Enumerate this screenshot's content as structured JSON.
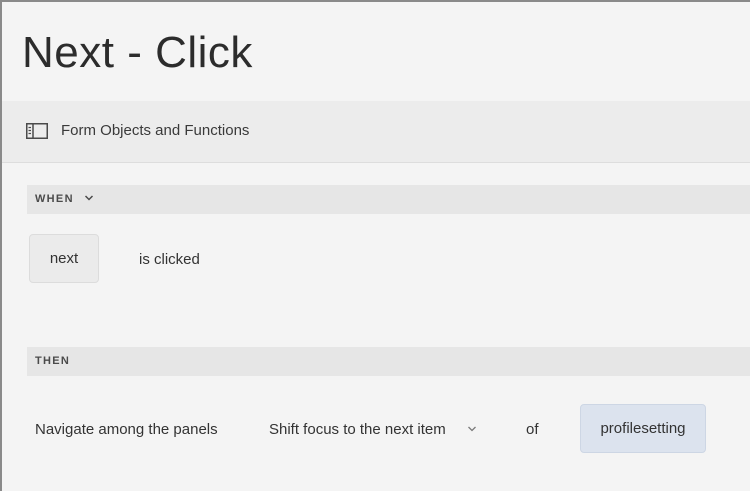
{
  "page": {
    "title": "Next - Click"
  },
  "toolbar": {
    "icon": "panel-icon",
    "label": "Form Objects and Functions"
  },
  "when": {
    "label": "WHEN",
    "icon": "chevron-down-icon",
    "object_token": "next",
    "event_text": "is clicked"
  },
  "then": {
    "label": "THEN",
    "action_text": "Navigate among the panels",
    "option_selected": "Shift focus to the next item",
    "option_icon": "chevron-down-icon",
    "of_text": "of",
    "target_token": "profilesetting"
  },
  "colors": {
    "background": "#f4f4f4",
    "toolbar": "#ececec",
    "section_bar": "#e6e6e6",
    "token": "#ebebeb",
    "target_token": "#dce3ee"
  }
}
